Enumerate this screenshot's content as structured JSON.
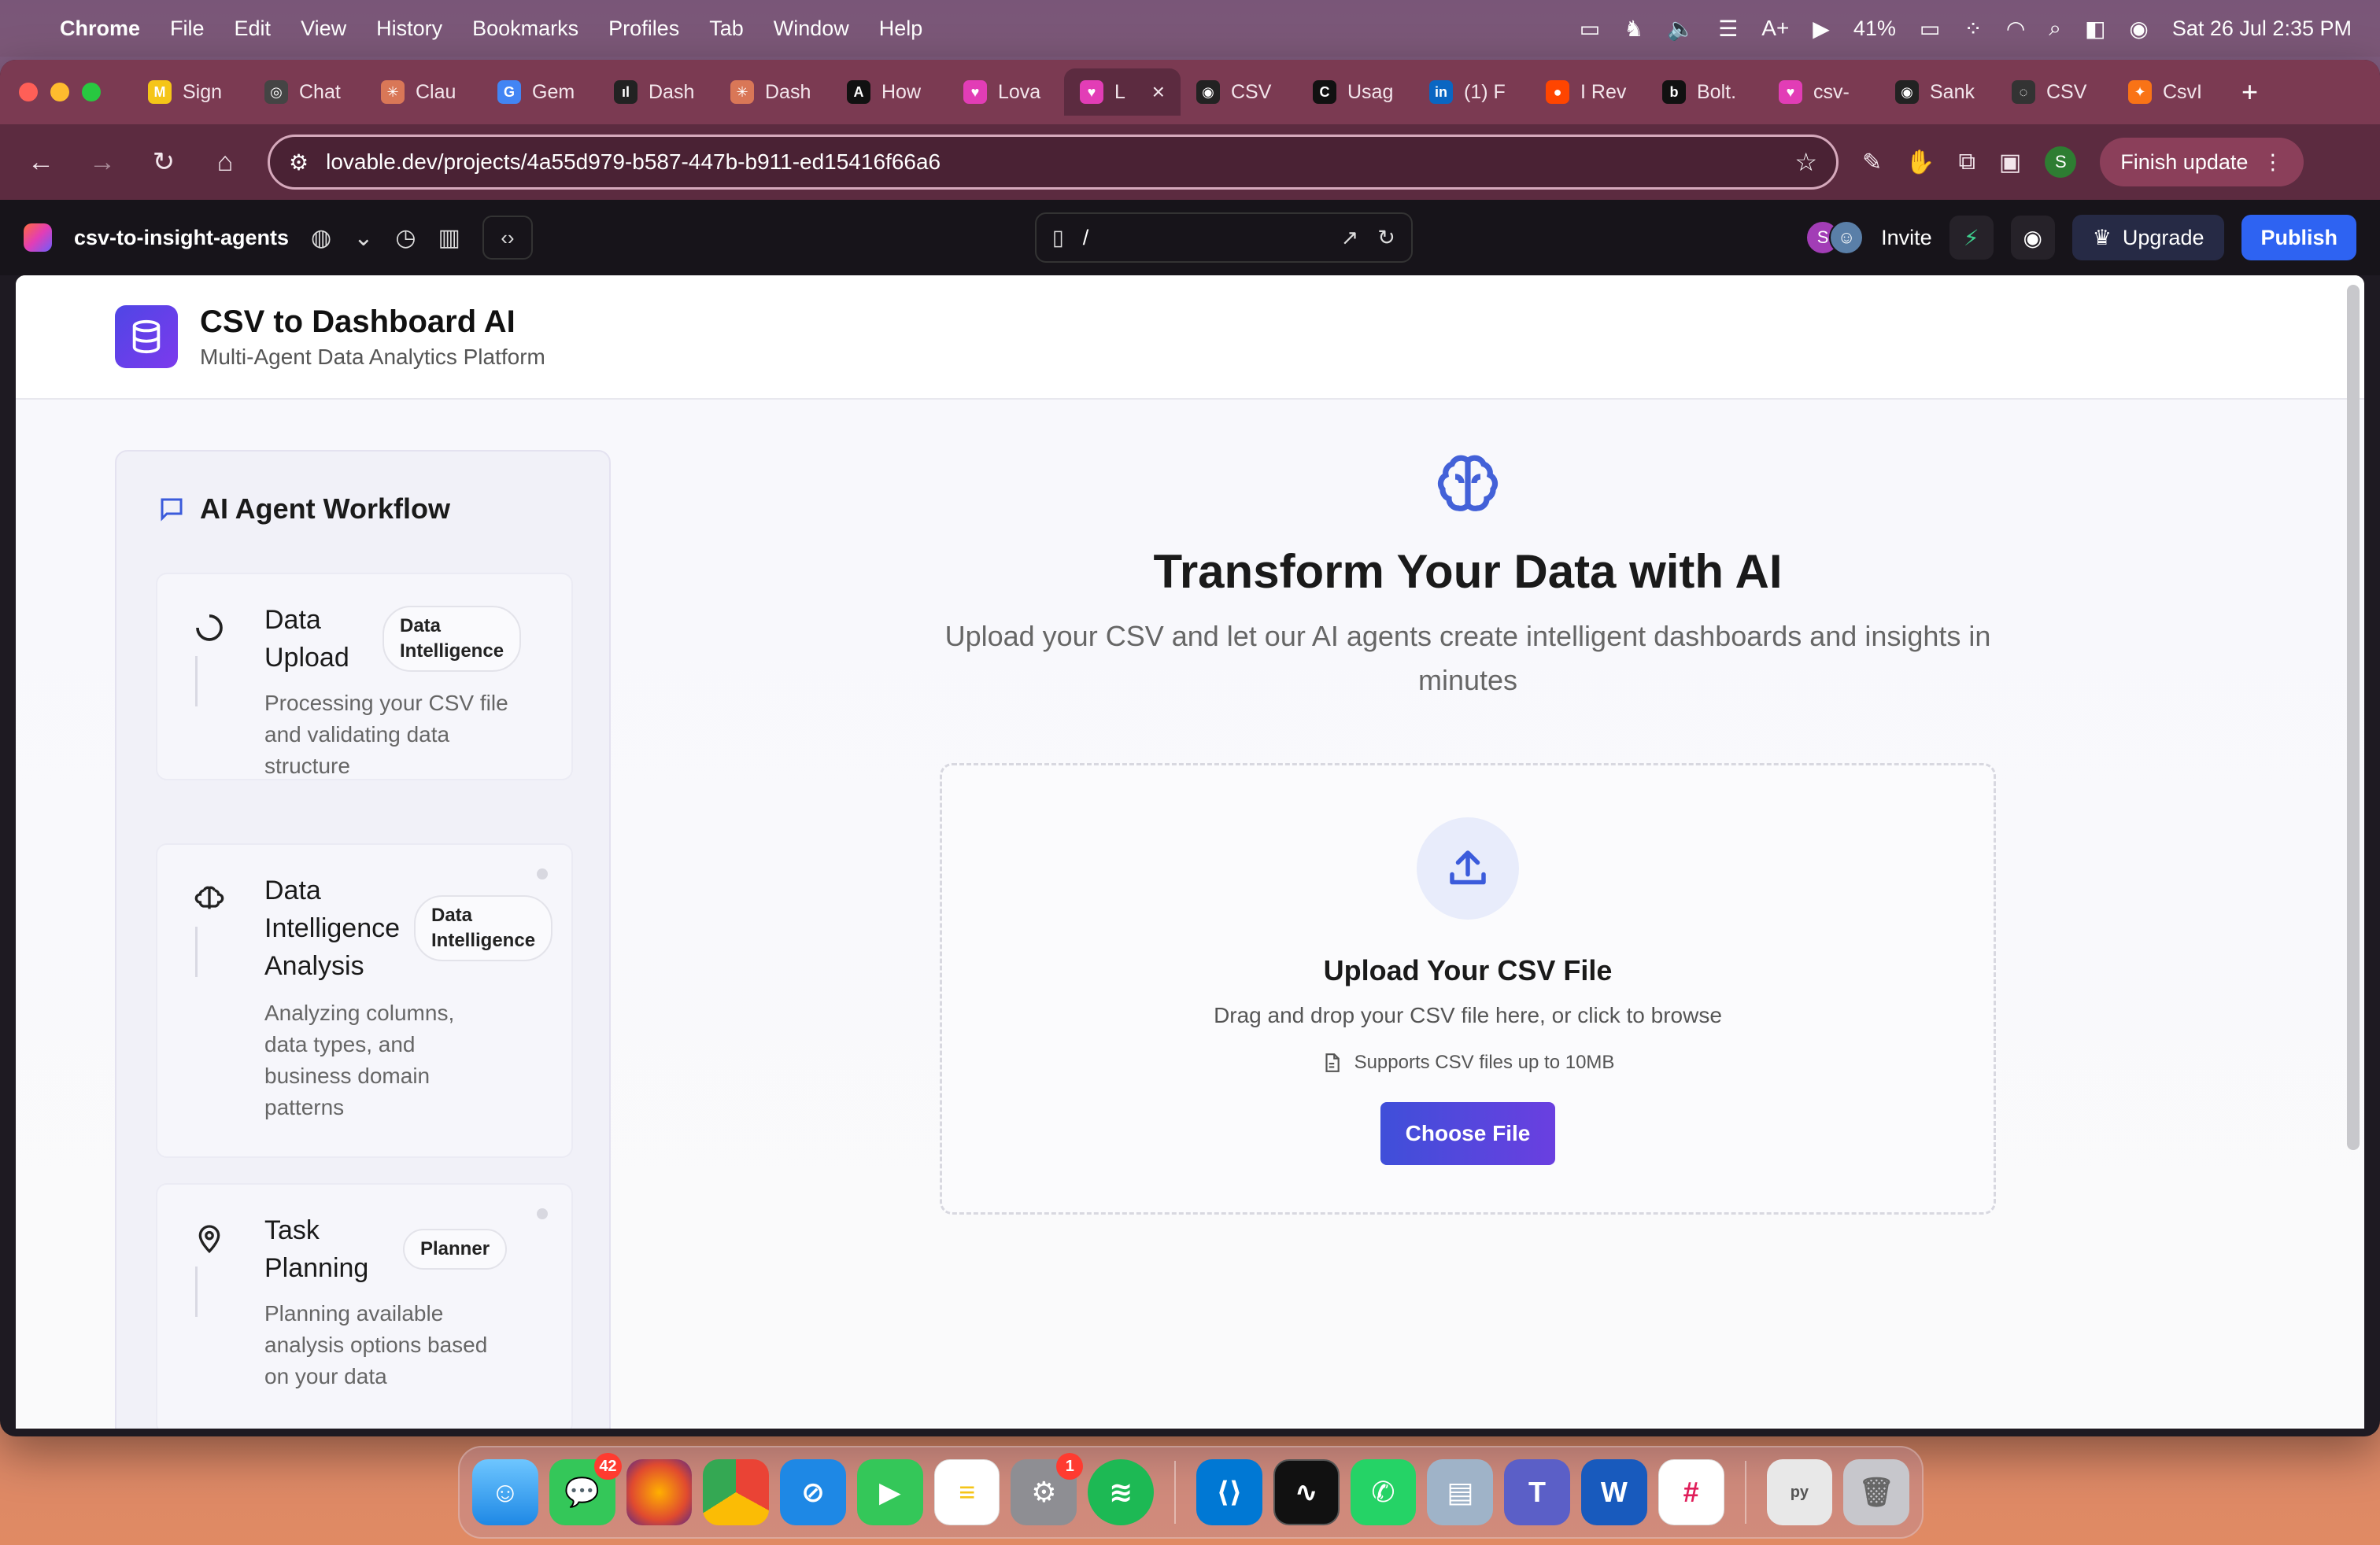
{
  "menubar": {
    "app": "Chrome",
    "items": [
      "File",
      "Edit",
      "View",
      "History",
      "Bookmarks",
      "Profiles",
      "Tab",
      "Window",
      "Help"
    ],
    "battery": "41%",
    "datetime": "Sat 26 Jul  2:35 PM"
  },
  "tabs": [
    {
      "label": "Sign",
      "color": "#f5c518",
      "glyph": "M"
    },
    {
      "label": "Chat",
      "color": "#444",
      "glyph": "◎"
    },
    {
      "label": "Clau",
      "color": "#d97757",
      "glyph": "✳"
    },
    {
      "label": "Gem",
      "color": "#4285f4",
      "glyph": "G"
    },
    {
      "label": "Dash",
      "color": "#222",
      "glyph": "ıl"
    },
    {
      "label": "Dash",
      "color": "#d97757",
      "glyph": "✳"
    },
    {
      "label": "How",
      "color": "#111",
      "glyph": "A"
    },
    {
      "label": "Lova",
      "color": "#e23db6",
      "glyph": "♥"
    },
    {
      "label": "L",
      "color": "#e23db6",
      "glyph": "♥",
      "active": true
    },
    {
      "label": "CSV",
      "color": "#222",
      "glyph": "◉"
    },
    {
      "label": "Usag",
      "color": "#111",
      "glyph": "C"
    },
    {
      "label": "(1) F",
      "color": "#0a66c2",
      "glyph": "in"
    },
    {
      "label": "I Rev",
      "color": "#ff4500",
      "glyph": "●"
    },
    {
      "label": "Bolt.",
      "color": "#111",
      "glyph": "b"
    },
    {
      "label": "csv-",
      "color": "#e23db6",
      "glyph": "♥"
    },
    {
      "label": "Sank",
      "color": "#222",
      "glyph": "◉"
    },
    {
      "label": "CSV",
      "color": "#333",
      "glyph": "◌"
    },
    {
      "label": "CsvI",
      "color": "#f97316",
      "glyph": "✦"
    }
  ],
  "toolbar": {
    "url": "lovable.dev/projects/4a55d979-b587-447b-b911-ed15416f66a6",
    "profile_initial": "S",
    "finish_update": "Finish update"
  },
  "lovable": {
    "project_name": "csv-to-insight-agents",
    "preview_path": "/",
    "invite": "Invite",
    "avatar_initial": "S",
    "upgrade": "Upgrade",
    "publish": "Publish"
  },
  "app": {
    "title": "CSV to Dashboard AI",
    "subtitle": "Multi-Agent Data Analytics Platform"
  },
  "workflow": {
    "title": "AI Agent Workflow",
    "steps": [
      {
        "title_line1": "Data",
        "title_line2": "Upload",
        "title_line3": "",
        "badge_line1": "Data",
        "badge_line2": "Intelligence",
        "desc": [
          "Processing your CSV file",
          "and validating data",
          "structure"
        ]
      },
      {
        "title_line1": "Data",
        "title_line2": "Intelligence",
        "title_line3": "Analysis",
        "badge_line1": "Data",
        "badge_line2": "Intelligence",
        "desc": [
          "Analyzing columns,",
          "data types, and",
          "business domain",
          "patterns"
        ]
      },
      {
        "title_line1": "Task",
        "title_line2": "Planning",
        "title_line3": "",
        "badge_line1": "Planner",
        "badge_line2": "",
        "desc": [
          "Planning available",
          "analysis options based",
          "on your data"
        ]
      }
    ]
  },
  "hero": {
    "title": "Transform Your Data with AI",
    "subtitle": "Upload your CSV and let our AI agents create intelligent dashboards and insights in minutes"
  },
  "upload": {
    "title": "Upload Your CSV File",
    "subtitle": "Drag and drop your CSV file here, or click to browse",
    "note": "Supports CSV files up to 10MB",
    "button": "Choose File"
  },
  "dock": {
    "messages_badge": "42",
    "settings_badge": "1"
  },
  "colors": {
    "accent": "#4f46e5",
    "publish": "#2e63f2",
    "tabstrip": "#7b3a52"
  }
}
